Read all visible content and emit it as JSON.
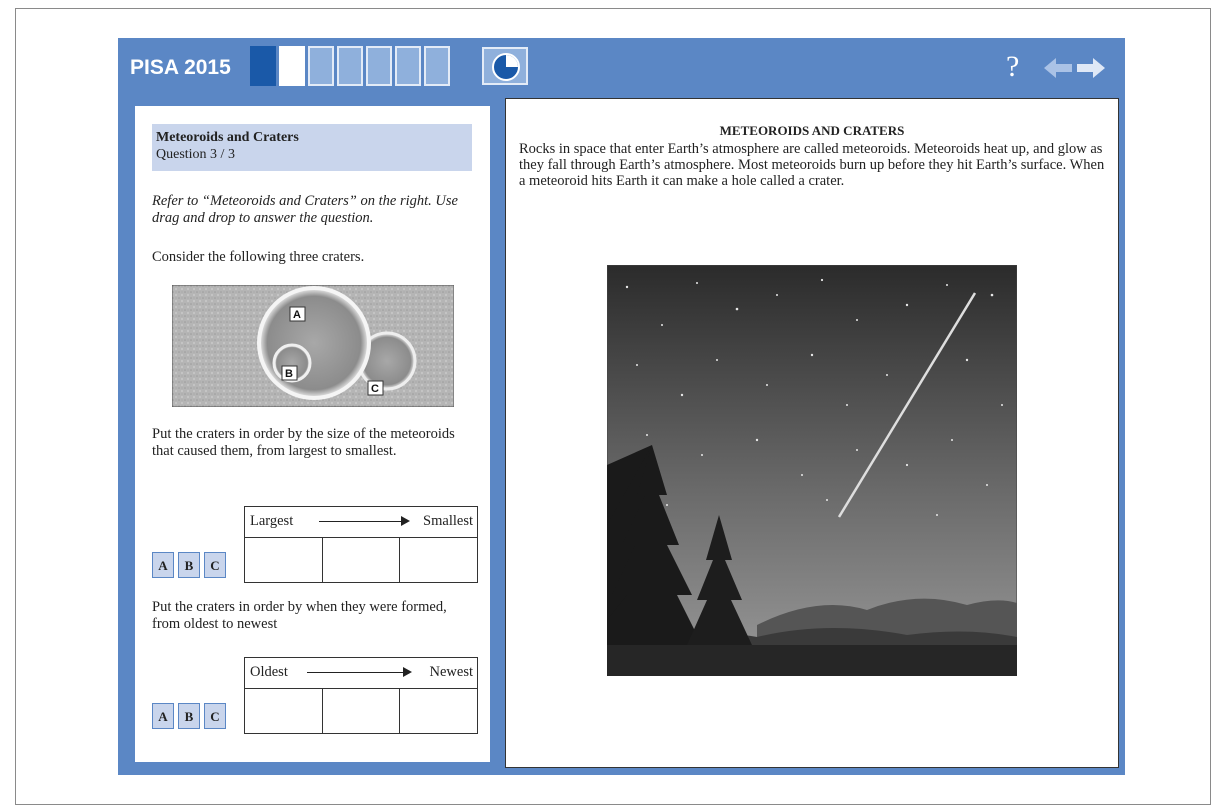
{
  "header": {
    "app_title": "PISA 2015",
    "help_label": "?"
  },
  "question": {
    "title": "Meteoroids and Craters",
    "number": "Question 3 / 3",
    "instructions": "Refer to “Meteoroids and Craters” on the right. Use drag and drop to answer the question.",
    "consider": "Consider the following three craters.",
    "crater_labels": [
      "A",
      "B",
      "C"
    ],
    "prompt_size": "Put the craters in order by the size of the meteoroids that caused them, from largest to smallest.",
    "size_table": {
      "left": "Largest",
      "right": "Smallest"
    },
    "prompt_age": "Put the craters in order by when they were formed, from oldest to newest",
    "age_table": {
      "left": "Oldest",
      "right": "Newest"
    },
    "chips": [
      "A",
      "B",
      "C"
    ]
  },
  "stimulus": {
    "title": "METEOROIDS AND CRATERS",
    "text": "Rocks in space that enter Earth’s atmosphere are called meteoroids. Meteoroids heat up, and glow as they fall through Earth’s atmosphere. Most meteoroids burn up before they hit Earth’s surface. When a meteoroid hits Earth it can make a hole called a crater."
  },
  "colors": {
    "frame_blue": "#5b87c5",
    "progress_done": "#1a59a8",
    "header_band": "#c9d5ec"
  }
}
